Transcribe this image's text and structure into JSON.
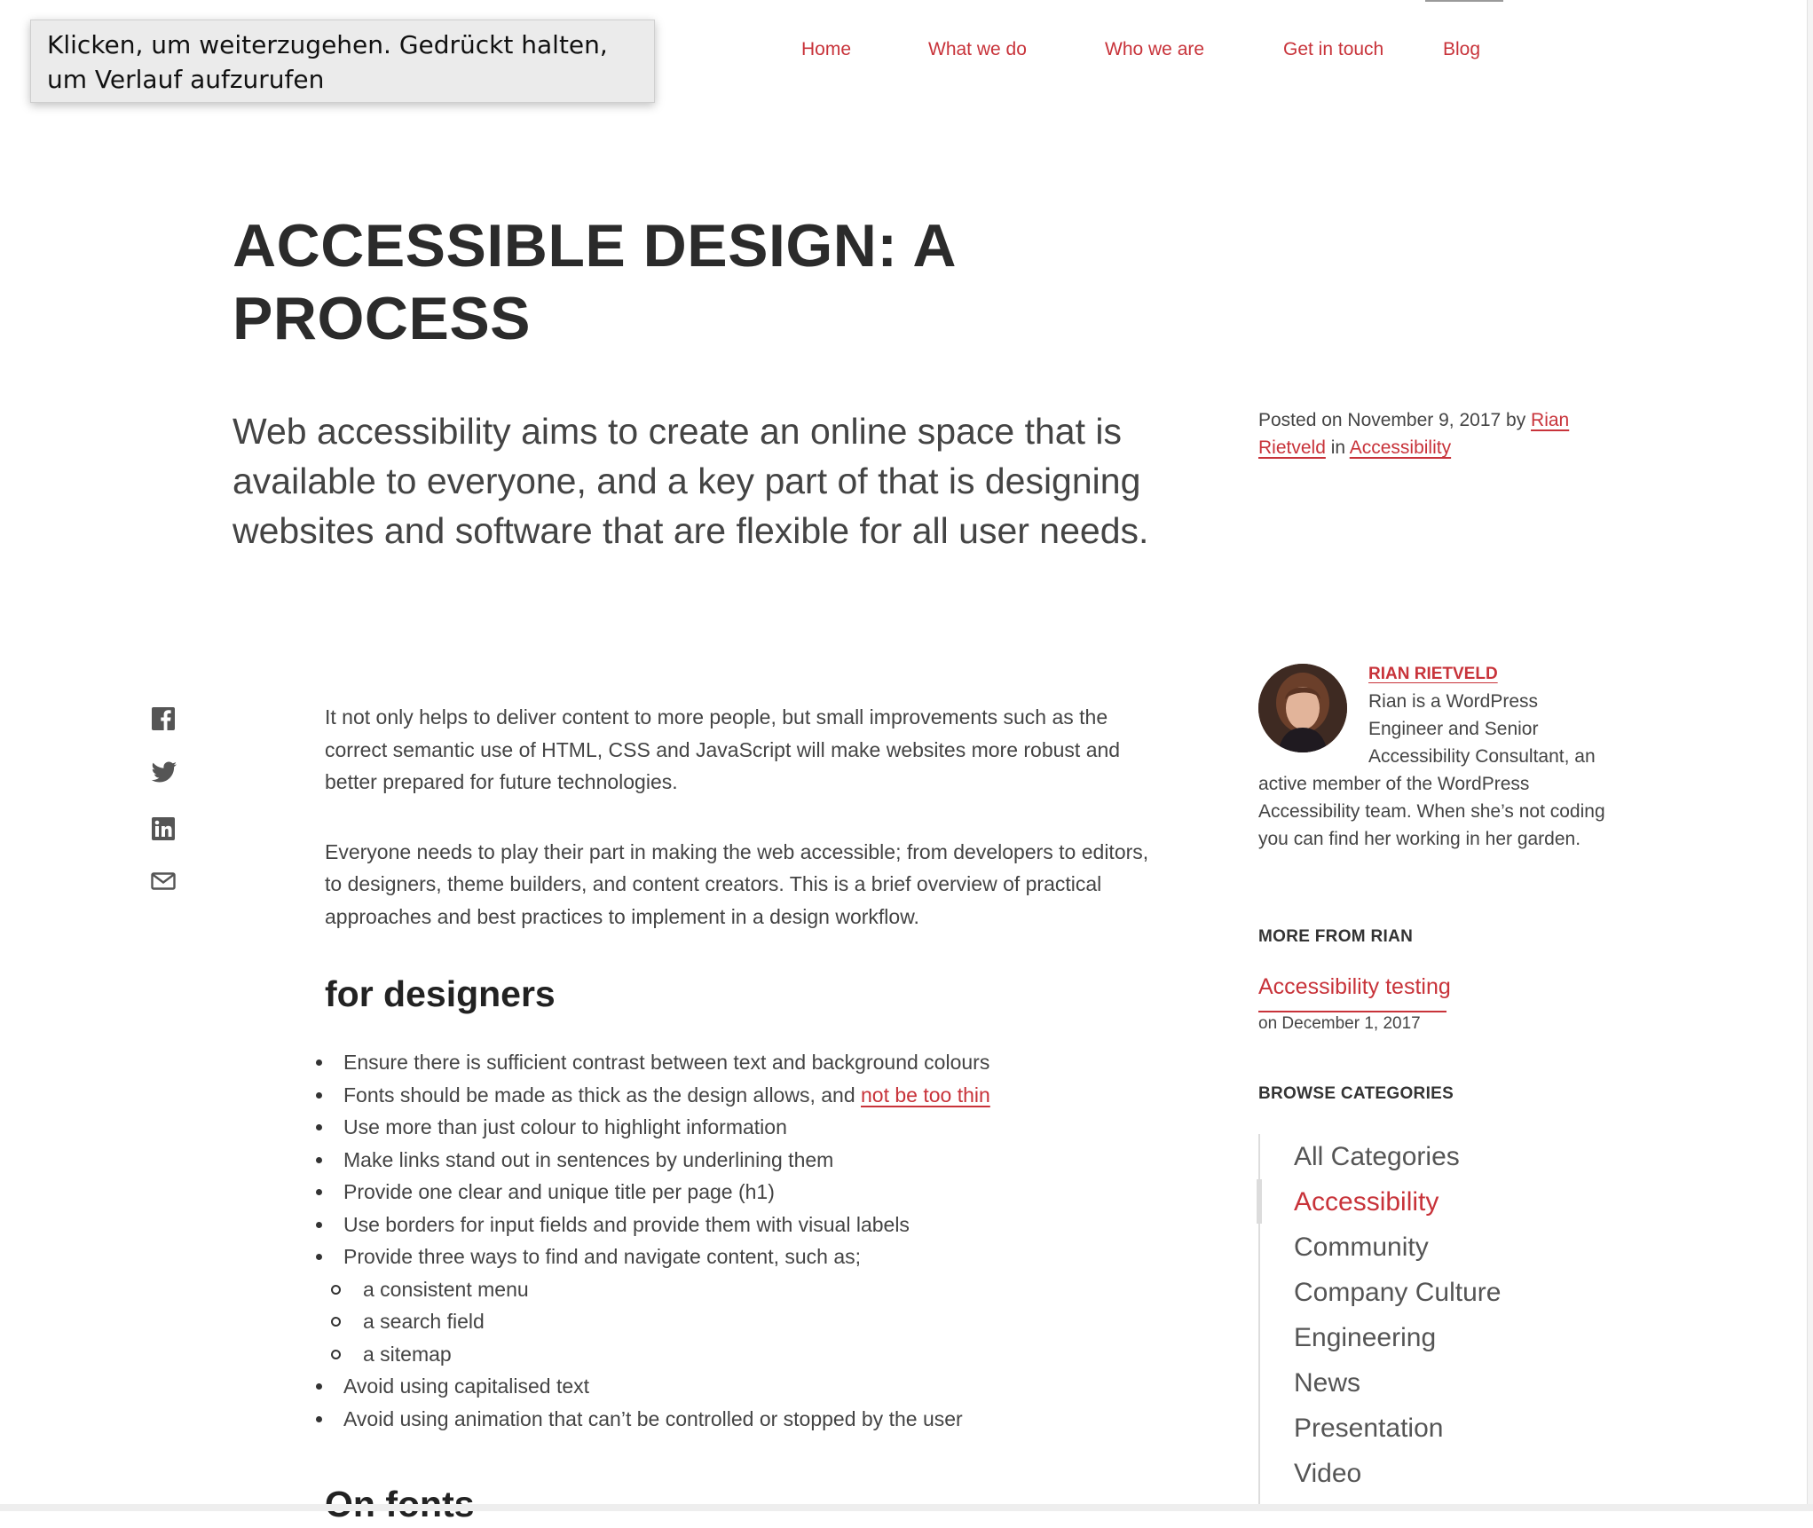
{
  "tooltip": {
    "line1": "Klicken, um weiterzugehen. Gedrückt halten,",
    "line2": "um Verlauf aufzurufen"
  },
  "nav": {
    "items": [
      {
        "label": "Home"
      },
      {
        "label": "What we do"
      },
      {
        "label": "Who we are"
      },
      {
        "label": "Get in touch"
      },
      {
        "label": "Blog"
      }
    ]
  },
  "article": {
    "title_line1": "ACCESSIBLE DESIGN: A",
    "title_line2": "PROCESS",
    "intro": "Web accessibility aims to create an online space that is available to everyone, and a key part of that is designing websites and software that are flexible for all user needs.",
    "paragraph1": "It not only helps to deliver content to more people, but small improvements such as the correct semantic use of HTML, CSS and JavaScript will make websites more robust and better prepared for future technologies.",
    "paragraph2": "Everyone needs to play their part in making the web accessible; from developers to editors, to designers, theme builders, and content creators. This is a brief overview of practical approaches and best practices to implement in a design workflow.",
    "heading": "for designers",
    "list": {
      "item1": "Ensure there is sufficient contrast between text and background colours",
      "item2_text": "Fonts should be made as thick as the design allows, and ",
      "item2_link": "not be too thin",
      "item3": "Use more than just colour to highlight information",
      "item4": "Make links stand out in sentences by underlining them",
      "item5": "Provide one clear and unique title per page (h1)",
      "item6": "Use borders for input fields and provide them with visual labels",
      "item7": "Provide three ways to find and navigate content, such as;",
      "sub1": "a consistent menu",
      "sub2": "a search field",
      "sub3": "a sitemap",
      "item8": "Avoid using capitalised text",
      "item9": "Avoid using animation that can’t be controlled or stopped by the user"
    },
    "next_heading": "On fonts"
  },
  "meta": {
    "posted_prefix": "Posted on November 9, 2017 by ",
    "author_link": "Rian Rietveld",
    "in_text": " in ",
    "category_link": "Accessibility"
  },
  "share": {
    "icons": [
      "facebook-icon",
      "twitter-icon",
      "linkedin-icon",
      "mail-icon"
    ]
  },
  "sidebar": {
    "author_name": "RIAN RIETVELD",
    "author_bio": "Rian is a WordPress Engineer and Senior Accessibility Consultant, an active member of the WordPress Accessibility team. When she’s not coding you can find her working in her garden.",
    "more_label": "MORE FROM RIAN",
    "more_link": "Accessibility testing",
    "more_date": "on December 1, 2017",
    "browse_label": "BROWSE CATEGORIES",
    "categories": [
      {
        "label": "All Categories"
      },
      {
        "label": "Accessibility"
      },
      {
        "label": "Community"
      },
      {
        "label": "Company Culture"
      },
      {
        "label": "Engineering"
      },
      {
        "label": "News"
      },
      {
        "label": "Presentation"
      },
      {
        "label": "Video"
      }
    ]
  },
  "colors": {
    "accent": "#c8333a",
    "text": "#444444",
    "heading": "#2b2b2b"
  }
}
